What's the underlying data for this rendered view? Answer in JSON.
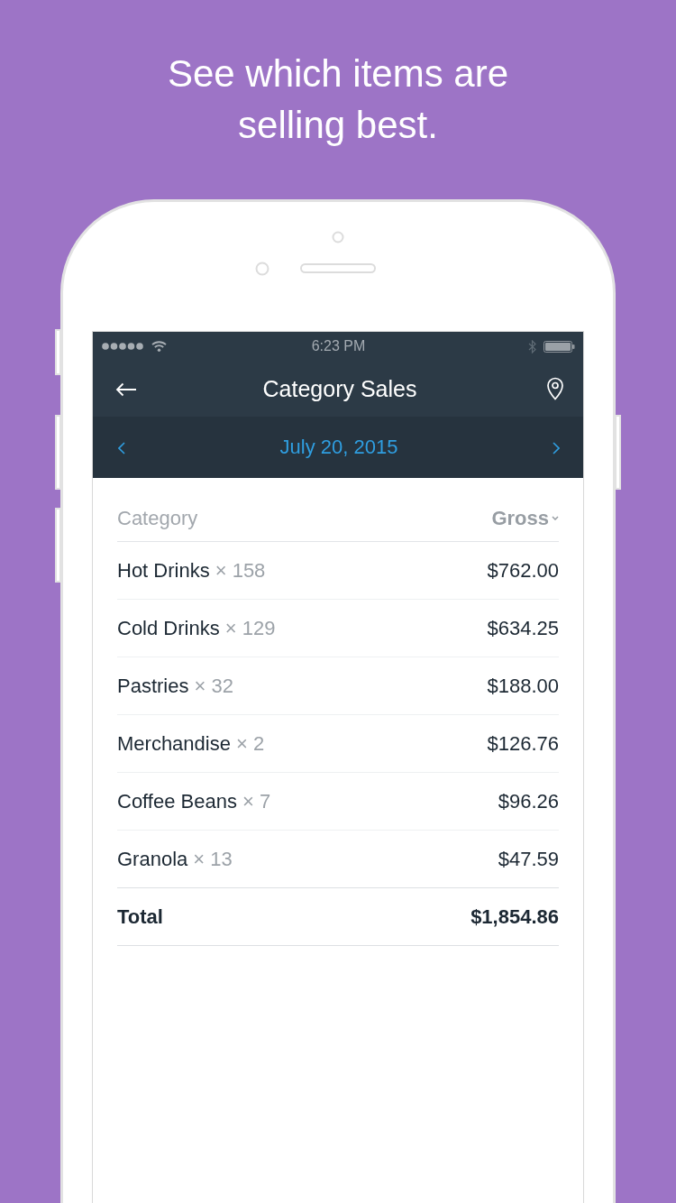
{
  "headline": "See which items are selling best.",
  "status_bar": {
    "time": "6:23 PM"
  },
  "nav_bar": {
    "title": "Category Sales"
  },
  "date_bar": {
    "date": "July 20, 2015"
  },
  "table": {
    "columns": [
      {
        "label": "Category",
        "sorted": false
      },
      {
        "label": "Gross",
        "sorted": true
      }
    ],
    "rows": [
      {
        "category": "Hot Drinks",
        "count": "× 158",
        "gross": "$762.00"
      },
      {
        "category": "Cold Drinks",
        "count": "× 129",
        "gross": "$634.25"
      },
      {
        "category": "Pastries",
        "count": "× 32",
        "gross": "$188.00"
      },
      {
        "category": "Merchandise",
        "count": "× 2",
        "gross": "$126.76"
      },
      {
        "category": "Coffee Beans",
        "count": "× 7",
        "gross": "$96.26"
      },
      {
        "category": "Granola",
        "count": "× 13",
        "gross": "$47.59"
      }
    ],
    "total": {
      "label": "Total",
      "gross": "$1,854.86"
    }
  }
}
